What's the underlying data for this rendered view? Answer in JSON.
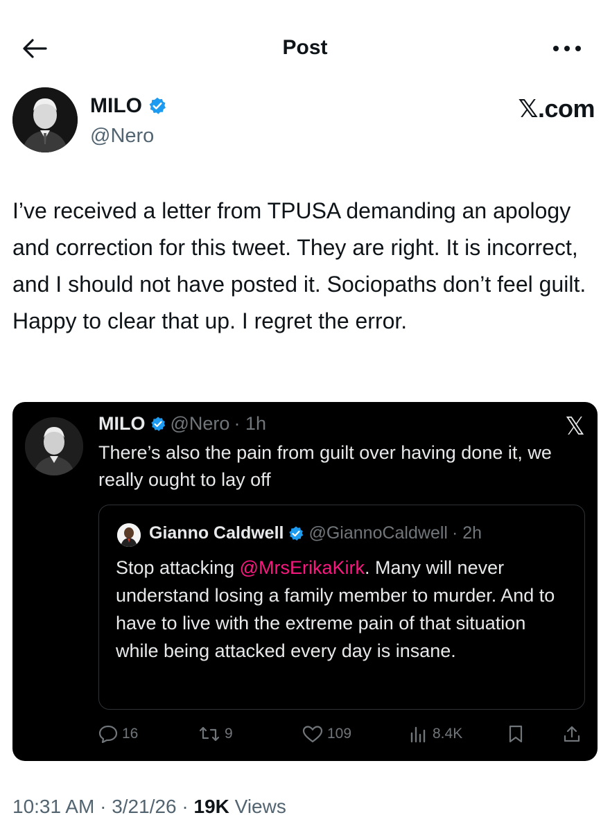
{
  "header": {
    "title": "Post",
    "back_icon": "arrow-left-icon",
    "more_icon": "more-horizontal-icon"
  },
  "author": {
    "name": "MILO",
    "handle": "@Nero",
    "verified": true,
    "verified_color": "#1d9bf0"
  },
  "site_mark": "𝕏.com",
  "post": {
    "text": "I’ve received a letter from TPUSA demanding an apology and correction for this tweet. They are right. It is incorrect, and I should not have posted it. Sociopaths don’t feel guilt. Happy to clear that up. I regret the error."
  },
  "embedded_tweet": {
    "name": "MILO",
    "handle": "@Nero",
    "time": "· 1h",
    "x_logo": "𝕏",
    "text": "There’s also the pain from guilt over having done it, we really ought to lay off",
    "quoted": {
      "name": "Gianno Caldwell",
      "handle": "@GiannoCaldwell",
      "time": "· 2h",
      "text_before": "Stop attacking ",
      "mention": "@MrsErikaKirk",
      "text_after": ". Many will never understand losing a family member to murder. And to have to live with the extreme pain of that situation while being attacked every day is insane.",
      "mention_color": "#f91880"
    },
    "actions": {
      "replies": "16",
      "reposts": "9",
      "likes": "109",
      "views": "8.4K"
    }
  },
  "footer": {
    "time": "10:31 AM",
    "sep1": " · ",
    "date": "3/21/26",
    "sep2": " · ",
    "views_count": "19K",
    "views_label": " Views"
  }
}
